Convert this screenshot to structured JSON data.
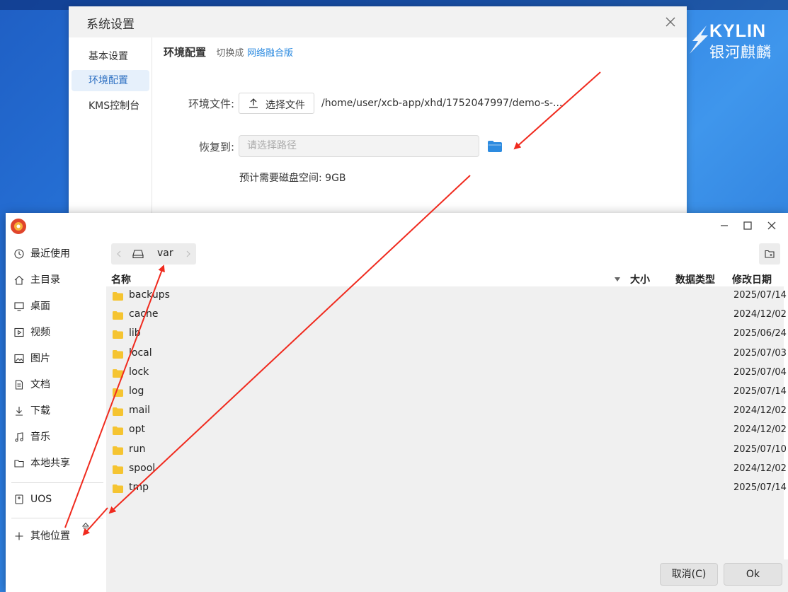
{
  "desktop": {
    "logo_en": "KYLIN",
    "logo_cn": "银河麒麟"
  },
  "settings_window": {
    "title": "系统设置",
    "nav": [
      "基本设置",
      "环境配置",
      "KMS控制台"
    ],
    "active_nav": "环境配置",
    "section_title": "环境配置",
    "switch_prefix": "切换成",
    "switch_link": "网络融合版",
    "env_file_label": "环境文件:",
    "choose_file_button": "选择文件",
    "env_file_path": "/home/user/xcb-app/xhd/1752047997/demo-s-...",
    "restore_label": "恢复到:",
    "restore_placeholder": "请选择路径",
    "disk_space_text": "预计需要磁盘空间: 9GB"
  },
  "file_dialog": {
    "sidebar": [
      {
        "label": "最近使用",
        "icon": "clock-icon"
      },
      {
        "label": "主目录",
        "icon": "home-icon"
      },
      {
        "label": "桌面",
        "icon": "desktop-icon"
      },
      {
        "label": "视频",
        "icon": "video-icon"
      },
      {
        "label": "图片",
        "icon": "image-icon"
      },
      {
        "label": "文档",
        "icon": "document-icon"
      },
      {
        "label": "下载",
        "icon": "download-icon"
      },
      {
        "label": "音乐",
        "icon": "music-icon"
      },
      {
        "label": "本地共享",
        "icon": "folder-icon"
      }
    ],
    "device": {
      "label": "UOS",
      "icon": "drive-icon"
    },
    "other_locations": "其他位置",
    "path_segment": "var",
    "columns": {
      "name": "名称",
      "size": "大小",
      "type": "数据类型",
      "modified": "修改日期"
    },
    "files": [
      {
        "name": "backups",
        "modified": "2025/07/14"
      },
      {
        "name": "cache",
        "modified": "2024/12/02"
      },
      {
        "name": "lib",
        "modified": "2025/06/24"
      },
      {
        "name": "local",
        "modified": "2025/07/03"
      },
      {
        "name": "lock",
        "modified": "2025/07/04"
      },
      {
        "name": "log",
        "modified": "2025/07/14"
      },
      {
        "name": "mail",
        "modified": "2024/12/02"
      },
      {
        "name": "opt",
        "modified": "2024/12/02"
      },
      {
        "name": "run",
        "modified": "2025/07/10"
      },
      {
        "name": "spool",
        "modified": "2024/12/02"
      },
      {
        "name": "tmp",
        "modified": "2025/07/14"
      }
    ],
    "cancel_button": "取消(C)",
    "ok_button": "Ok"
  },
  "colors": {
    "accent": "#2d8be0",
    "folder": "#f5c431",
    "arrow": "#f02a1e"
  }
}
